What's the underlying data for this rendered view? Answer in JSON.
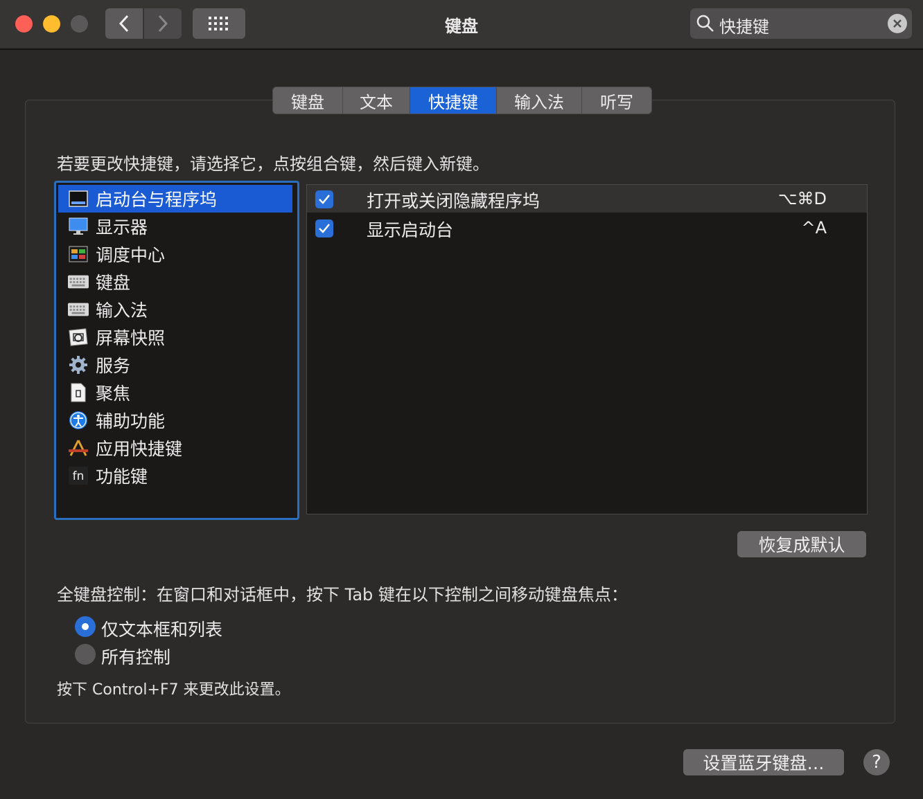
{
  "window": {
    "title": "键盘",
    "search": {
      "value": "快捷键"
    }
  },
  "tabs": [
    {
      "label": "键盘"
    },
    {
      "label": "文本"
    },
    {
      "label": "快捷键",
      "active": true
    },
    {
      "label": "输入法"
    },
    {
      "label": "听写"
    }
  ],
  "instruction": "若要更改快捷键，请选择它，点按组合键，然后键入新键。",
  "categories": [
    {
      "label": "启动台与程序坞",
      "icon": "launchpad-dock-icon",
      "selected": true
    },
    {
      "label": "显示器",
      "icon": "display-icon"
    },
    {
      "label": "调度中心",
      "icon": "mission-control-icon"
    },
    {
      "label": "键盘",
      "icon": "keyboard-icon"
    },
    {
      "label": "输入法",
      "icon": "input-source-icon"
    },
    {
      "label": "屏幕快照",
      "icon": "screenshot-icon"
    },
    {
      "label": "服务",
      "icon": "gear-icon"
    },
    {
      "label": "聚焦",
      "icon": "spotlight-icon"
    },
    {
      "label": "辅助功能",
      "icon": "accessibility-icon"
    },
    {
      "label": "应用快捷键",
      "icon": "app-shortcuts-icon"
    },
    {
      "label": "功能键",
      "icon": "fn-key-icon"
    }
  ],
  "shortcuts": [
    {
      "checked": true,
      "description": "打开或关闭隐藏程序坞",
      "key": "⌥⌘D"
    },
    {
      "checked": true,
      "description": "显示启动台",
      "key": "^A"
    }
  ],
  "buttons": {
    "restore_defaults": "恢复成默认",
    "setup_bluetooth": "设置蓝牙键盘…",
    "help": "?"
  },
  "full_keyboard_access": {
    "label": "全键盘控制：在窗口和对话框中，按下 Tab 键在以下控制之间移动键盘焦点：",
    "options": [
      {
        "label": "仅文本框和列表",
        "selected": true
      },
      {
        "label": "所有控制",
        "selected": false
      }
    ],
    "hint": "按下 Control+F7 来更改此设置。"
  },
  "colors": {
    "accent": "#1b62d6",
    "close": "#fe5f57",
    "minimize": "#febc2e",
    "zoom_disabled": "#5a5858"
  }
}
